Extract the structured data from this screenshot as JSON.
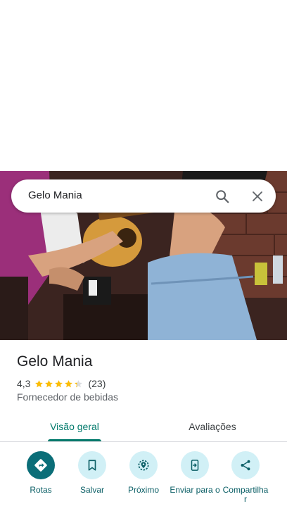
{
  "search": {
    "query": "Gelo Mania",
    "search_icon": "search-icon",
    "clear_icon": "close-icon"
  },
  "place": {
    "name": "Gelo Mania",
    "rating": "4,3",
    "stars_value": 4.3,
    "reviews": "(23)",
    "category": "Fornecedor de bebidas"
  },
  "tabs": [
    {
      "label": "Visão geral",
      "active": true
    },
    {
      "label": "Avaliações",
      "active": false
    }
  ],
  "actions": [
    {
      "label": "Rotas",
      "icon": "directions-icon"
    },
    {
      "label": "Salvar",
      "icon": "bookmark-icon"
    },
    {
      "label": "Próximo",
      "icon": "nearby-icon"
    },
    {
      "label": "Enviar para o",
      "icon": "send-to-phone-icon"
    },
    {
      "label": "Compartilha r",
      "icon": "share-icon"
    }
  ],
  "colors": {
    "accent": "#00796b",
    "action_bg": "#d1f0f6",
    "action_primary": "#0b6e78",
    "star": "#fbbc04"
  }
}
